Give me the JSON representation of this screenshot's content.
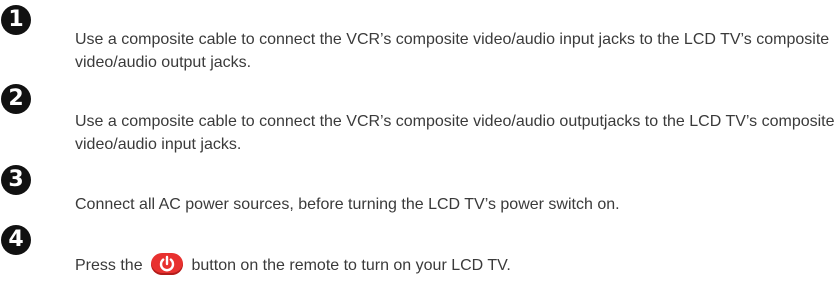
{
  "steps": [
    {
      "number": "1",
      "text": "Use a composite cable to connect the VCR’s composite video/audio input jacks to the LCD TV’s composite video/audio output jacks."
    },
    {
      "number": "2",
      "text": "Use a composite cable to connect the VCR’s composite video/audio outputjacks to the LCD TV’s composite video/audio input jacks."
    },
    {
      "number": "3",
      "text": "Connect all AC power sources, before turning the LCD TV’s power switch on."
    },
    {
      "number": "4",
      "text_before": "Press the",
      "button_icon": "power-icon",
      "text_after": "button on the remote to turn on your LCD TV."
    }
  ],
  "colors": {
    "text": "#3a3a3a",
    "step_badge": "#111111",
    "power_button": "#e8312f"
  }
}
